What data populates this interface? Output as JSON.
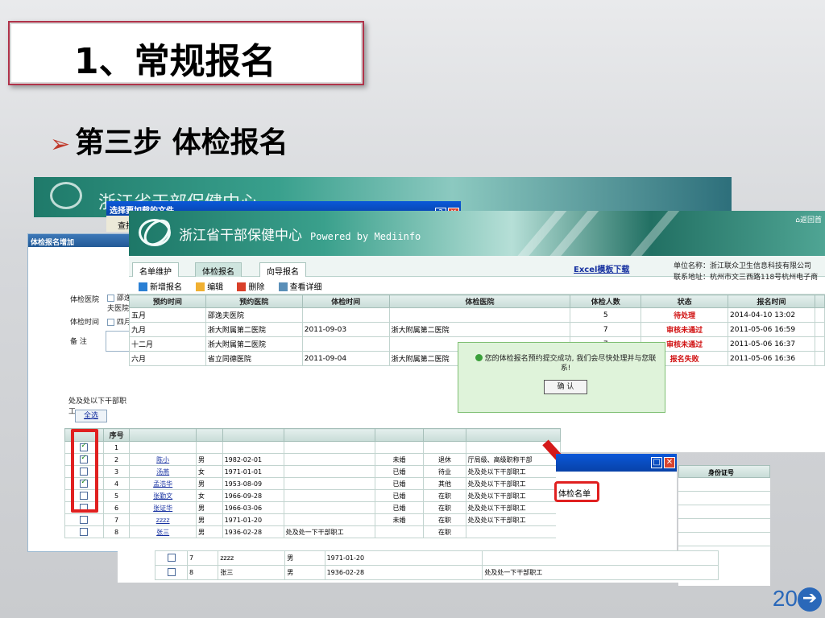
{
  "slide": {
    "title": "1、常规报名",
    "subtitle": "第三步 体检报名",
    "page_number": "20"
  },
  "bg_window": {
    "title": "浙江省干部保健中心",
    "file_dialog_title": "选择要加载的文件",
    "file_dialog_button": "查找"
  },
  "form_panel": {
    "title": "体检报名增加",
    "hospital_label": "体检医院",
    "hospital_option": "邵逸夫医院",
    "time_label": "体检时间",
    "time_option": "四月",
    "remark_label": "备 注",
    "group_label": "处及处以下干部职工",
    "select_all": "全选"
  },
  "main": {
    "app_name": "浙江省干部保健中心",
    "powered_by": "Powered by Mediinfo",
    "home_link": "返回首",
    "tabs": [
      "名单维护",
      "体检报名",
      "向导报名"
    ],
    "active_tab": "体检报名",
    "excel_link": "Excel模板下载",
    "unit_name": "单位名称：浙江联众卫生信息科技有限公司",
    "unit_address": "联系地址：杭州市文三西路118号杭州电子商",
    "toolbar": [
      "新增报名",
      "编辑",
      "删除",
      "查看详细"
    ],
    "columns": [
      "预约时间",
      "预约医院",
      "体检时间",
      "体检医院",
      "体检人数",
      "状态",
      "报名时间"
    ],
    "rows": [
      [
        "五月",
        "邵逸夫医院",
        "",
        "",
        "5",
        "待处理",
        "2014-04-10 13:02"
      ],
      [
        "九月",
        "浙大附属第二医院",
        "2011-09-03",
        "浙大附属第二医院",
        "7",
        "审核未通过",
        "2011-05-06 16:59"
      ],
      [
        "十二月",
        "浙大附属第二医院",
        "",
        "",
        "7",
        "审核未通过",
        "2011-05-06 16:37"
      ],
      [
        "六月",
        "省立同德医院",
        "2011-09-04",
        "浙大附属第二医院",
        "7",
        "报名失败",
        "2011-05-06 16:36"
      ]
    ],
    "popup_message": "您的体检报名预约提交成功, 我们会尽快处理并与您联系!",
    "popup_ok": "确 认"
  },
  "list_panel": {
    "columns": [
      "",
      "序号"
    ],
    "rows": [
      {
        "checked": true,
        "no": "1",
        "name": "",
        "sex": "",
        "birth": "",
        "dept": "",
        "marital": "",
        "status": "",
        "rank": ""
      },
      {
        "checked": true,
        "no": "2",
        "name": "陈小",
        "sex": "男",
        "birth": "1982-02-01",
        "dept": "",
        "marital": "未婚",
        "status": "退休",
        "rank": "厅局级、高级职称干部"
      },
      {
        "checked": false,
        "no": "3",
        "name": "汤燕",
        "sex": "女",
        "birth": "1971-01-01",
        "dept": "",
        "marital": "已婚",
        "status": "待业",
        "rank": "处及处以下干部职工"
      },
      {
        "checked": true,
        "no": "4",
        "name": "孟浩华",
        "sex": "男",
        "birth": "1953-08-09",
        "dept": "",
        "marital": "已婚",
        "status": "其他",
        "rank": "处及处以下干部职工"
      },
      {
        "checked": false,
        "no": "5",
        "name": "张勤文",
        "sex": "女",
        "birth": "1966-09-28",
        "dept": "",
        "marital": "已婚",
        "status": "在职",
        "rank": "处及处以下干部职工"
      },
      {
        "checked": false,
        "no": "6",
        "name": "张证华",
        "sex": "男",
        "birth": "1966-03-06",
        "dept": "",
        "marital": "已婚",
        "status": "在职",
        "rank": "处及处以下干部职工"
      },
      {
        "checked": false,
        "no": "7",
        "name": "zzzz",
        "sex": "男",
        "birth": "1971-01-20",
        "dept": "",
        "marital": "未婚",
        "status": "在职",
        "rank": "处及处以下干部职工"
      },
      {
        "checked": false,
        "no": "8",
        "name": "张三",
        "sex": "男",
        "birth": "1936-02-28",
        "dept": "处及处一下干部职工",
        "marital": "",
        "status": "在职",
        "rank": ""
      }
    ]
  },
  "side_dialog": {
    "button": "体检名单",
    "id_column": "身份证号"
  },
  "bottom_panel": {
    "rows": [
      {
        "no": "7",
        "name": "zzzz",
        "sex": "男",
        "birth": "1971-01-20"
      },
      {
        "no": "8",
        "name": "张三",
        "sex": "男",
        "birth": "1936-02-28",
        "dept": "处及处一下干部职工"
      }
    ]
  }
}
